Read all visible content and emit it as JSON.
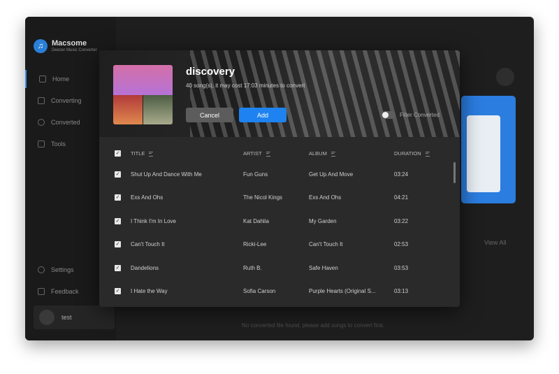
{
  "window": {
    "traffic_colors": [
      "#ec6a5e",
      "#f4bf4f",
      "#61c554"
    ]
  },
  "sidebar": {
    "app_name": "Macsome",
    "app_subtitle": "Deezer Music Converter",
    "items": [
      {
        "label": "Home",
        "icon": "home-icon",
        "active": true
      },
      {
        "label": "Converting",
        "icon": "converting-icon",
        "active": false
      },
      {
        "label": "Converted",
        "icon": "clock-icon",
        "active": false
      },
      {
        "label": "Tools",
        "icon": "toolbox-icon",
        "active": false
      }
    ],
    "bottom_items": [
      {
        "label": "Settings",
        "icon": "gear-icon"
      },
      {
        "label": "Feedback",
        "icon": "mail-icon"
      }
    ],
    "user": {
      "name": "test"
    }
  },
  "main": {
    "view_all": "View All",
    "empty_message": "No converted file found, please add songs to convert first."
  },
  "dialog": {
    "playlist_name": "discovery",
    "info": "40 song(s), it may cost 17:03 minutes to convert",
    "cancel_label": "Cancel",
    "add_label": "Add",
    "filter_label": "Filter Converted",
    "filter_enabled": false,
    "columns": [
      "TITLE",
      "ARTIST",
      "ALBUM",
      "DURATION"
    ],
    "tracks": [
      {
        "title": "Shut Up And Dance With Me",
        "artist": "Fun Guns",
        "album": "Get Up And Move",
        "duration": "03:24"
      },
      {
        "title": "Exs And Ohs",
        "artist": "The Nicol Kings",
        "album": "Exs And Ohs",
        "duration": "04:21"
      },
      {
        "title": "I Think I'm In Love",
        "artist": "Kat Dahlia",
        "album": "My Garden",
        "duration": "03:22"
      },
      {
        "title": "Can't Touch It",
        "artist": "Ricki-Lee",
        "album": "Can't Touch It",
        "duration": "02:53"
      },
      {
        "title": "Dandelions",
        "artist": "Ruth B.",
        "album": "Safe Haven",
        "duration": "03:53"
      },
      {
        "title": "I Hate the Way",
        "artist": "Sofia Carson",
        "album": "Purple Hearts (Original S...",
        "duration": "03:13"
      }
    ]
  }
}
